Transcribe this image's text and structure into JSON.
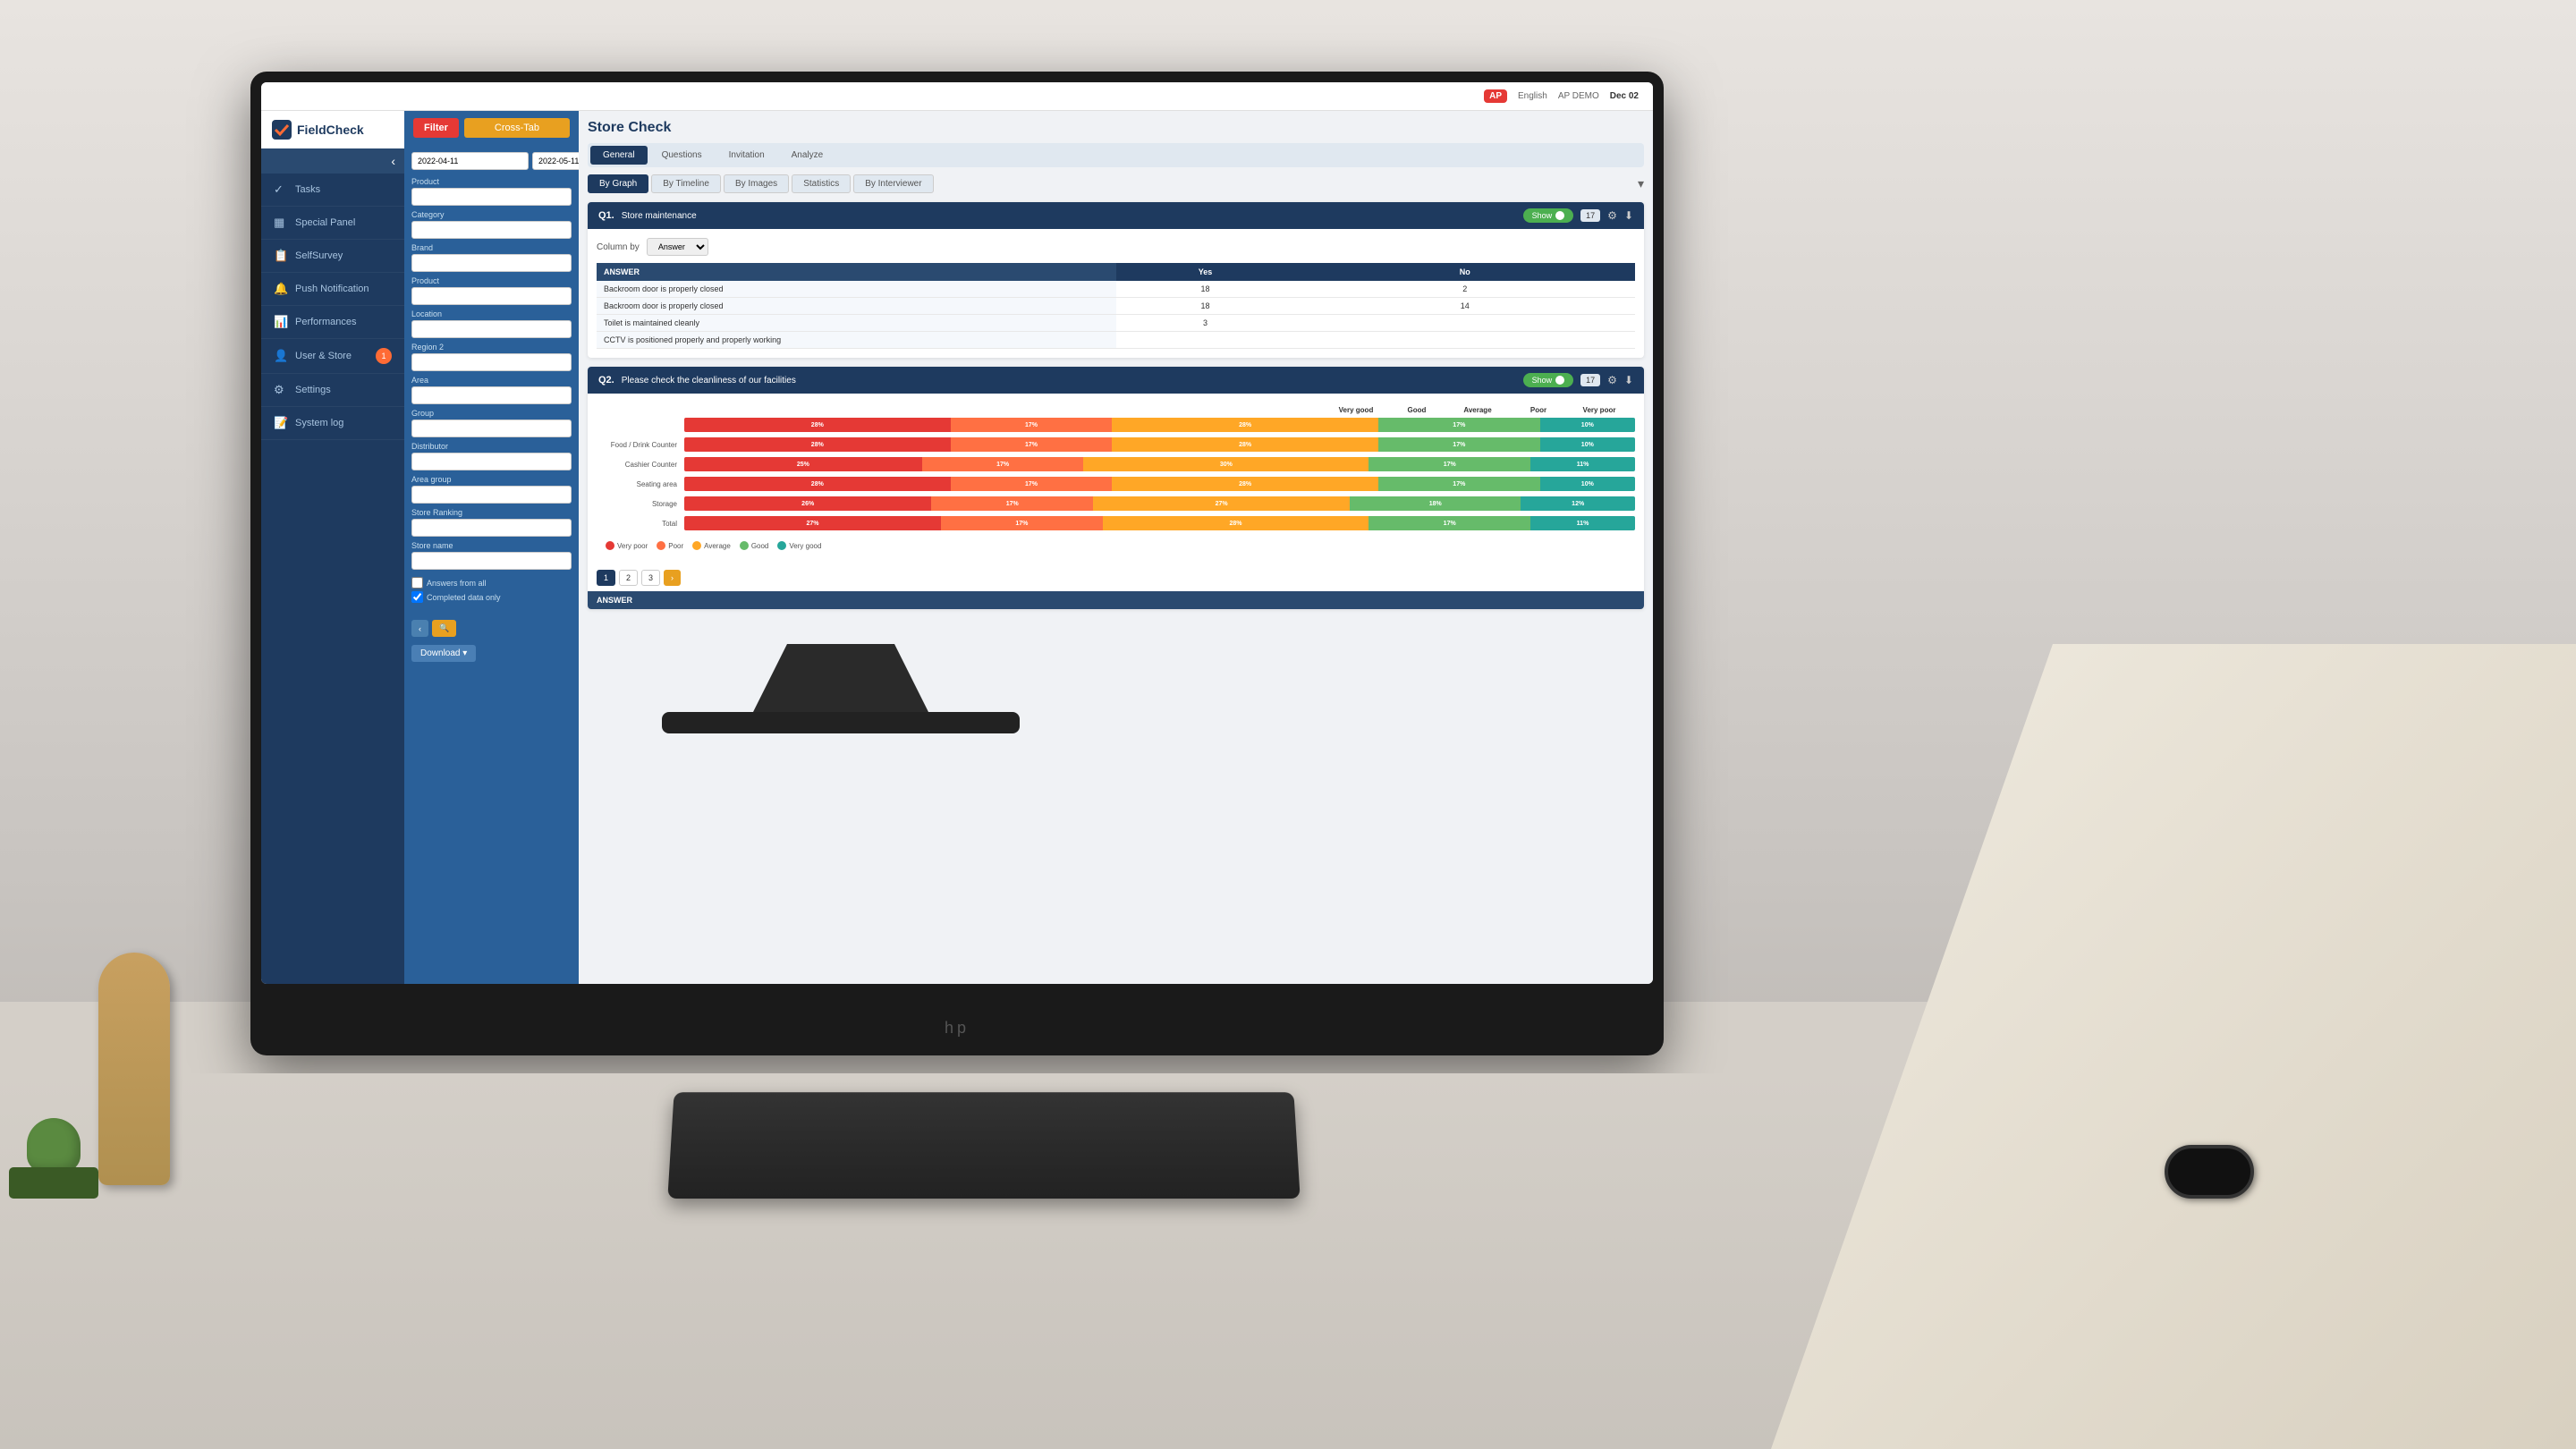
{
  "topbar": {
    "badge": "AP",
    "language": "English",
    "user": "AP DEMO",
    "date": "Dec 02"
  },
  "sidebar": {
    "logo": "FieldCheck",
    "items": [
      {
        "id": "tasks",
        "label": "Tasks",
        "icon": "✓",
        "active": false
      },
      {
        "id": "special-panel",
        "label": "Special Panel",
        "icon": "▦",
        "active": false
      },
      {
        "id": "selfsurvey",
        "label": "SelfSurvey",
        "icon": "📋",
        "active": false
      },
      {
        "id": "push-notification",
        "label": "Push Notification",
        "icon": "🔔",
        "active": false
      },
      {
        "id": "performances",
        "label": "Performances",
        "icon": "📊",
        "active": false
      },
      {
        "id": "user-store",
        "label": "User & Store",
        "icon": "👤",
        "active": false,
        "badge": "1"
      },
      {
        "id": "settings",
        "label": "Settings",
        "icon": "⚙",
        "active": false
      },
      {
        "id": "system-log",
        "label": "System log",
        "icon": "📝",
        "active": false
      }
    ]
  },
  "filter": {
    "filter_btn": "Filter",
    "cross_tab_btn": "Cross-Tab",
    "date_from": "2022-04-11",
    "date_to": "2022-05-11",
    "fields": [
      {
        "id": "product",
        "label": "Product",
        "value": ""
      },
      {
        "id": "category",
        "label": "Category",
        "value": ""
      },
      {
        "id": "brand",
        "label": "Brand",
        "value": ""
      },
      {
        "id": "product2",
        "label": "Product",
        "value": ""
      },
      {
        "id": "location",
        "label": "Location",
        "value": ""
      },
      {
        "id": "region2",
        "label": "Region 2",
        "value": ""
      },
      {
        "id": "area",
        "label": "Area",
        "value": ""
      },
      {
        "id": "group",
        "label": "Group",
        "value": ""
      },
      {
        "id": "distributor",
        "label": "Distributor",
        "value": ""
      },
      {
        "id": "area-group",
        "label": "Area group",
        "value": ""
      },
      {
        "id": "store-ranking",
        "label": "Store Ranking",
        "value": ""
      },
      {
        "id": "store-name",
        "label": "Store name",
        "value": ""
      }
    ],
    "options": [
      {
        "id": "answers-from-all",
        "label": "Answers from all",
        "checked": false
      },
      {
        "id": "completed-data-only",
        "label": "Completed data only",
        "checked": true
      }
    ],
    "download_btn": "Download ▾"
  },
  "page": {
    "title": "Store Check"
  },
  "tabs": {
    "main": [
      {
        "id": "general",
        "label": "General",
        "active": true
      },
      {
        "id": "questions",
        "label": "Questions",
        "active": false
      },
      {
        "id": "invitation",
        "label": "Invitation",
        "active": false
      },
      {
        "id": "analyze",
        "label": "Analyze",
        "active": false
      }
    ],
    "sub": [
      {
        "id": "by-graph",
        "label": "By Graph",
        "active": true
      },
      {
        "id": "by-timeline",
        "label": "By Timeline",
        "active": false
      },
      {
        "id": "by-images",
        "label": "By Images",
        "active": false
      },
      {
        "id": "statistics",
        "label": "Statistics",
        "active": false
      },
      {
        "id": "by-interviewer",
        "label": "By Interviewer",
        "active": false
      }
    ]
  },
  "questions": [
    {
      "id": "q1",
      "number": "Q1.",
      "title": "Store maintenance",
      "show": true,
      "count": "17",
      "column_by": "Answer",
      "headers": [
        "",
        "Yes",
        "",
        "No",
        ""
      ],
      "rows": [
        {
          "answer": "Backroom door is properly closed",
          "yes": "18",
          "yes_pct": "",
          "no": "2",
          "no_pct": ""
        },
        {
          "answer": "Backroom door is properly closed",
          "yes": "18",
          "yes_pct": "",
          "no": "14",
          "no_pct": ""
        },
        {
          "answer": "Toilet is maintained cleanly",
          "yes": "3",
          "yes_pct": "",
          "no": "",
          "no_pct": ""
        },
        {
          "answer": "CCTV is positioned properly and properly working",
          "yes": "",
          "yes_pct": "",
          "no": "",
          "no_pct": ""
        }
      ]
    },
    {
      "id": "q2",
      "number": "Q2.",
      "title": "Please check the cleanliness of our facilities",
      "show": true,
      "count": "17",
      "chart_rows": [
        {
          "label": "",
          "very_poor": 28,
          "poor": 17,
          "average": 28,
          "good": 17,
          "very_good": 10
        },
        {
          "label": "Food / Drink Counter",
          "very_poor": 28,
          "poor": 17,
          "average": 28,
          "good": 17,
          "very_good": 10
        },
        {
          "label": "Cashier Counter",
          "very_poor": 25,
          "poor": 17,
          "average": 30,
          "good": 17,
          "very_good": 11
        },
        {
          "label": "Seating area",
          "very_poor": 28,
          "poor": 17,
          "average": 28,
          "good": 17,
          "very_good": 10
        },
        {
          "label": "Storage",
          "very_poor": 26,
          "poor": 17,
          "average": 27,
          "good": 18,
          "very_good": 12
        },
        {
          "label": "Total",
          "very_poor": 27,
          "poor": 17,
          "average": 28,
          "good": 17,
          "very_good": 11
        }
      ],
      "legend": [
        {
          "label": "Very poor",
          "color": "#e53935"
        },
        {
          "label": "Poor",
          "color": "#ff7043"
        },
        {
          "label": "Average",
          "color": "#ffa726"
        },
        {
          "label": "Good",
          "color": "#66bb6a"
        },
        {
          "label": "Very good",
          "color": "#26a69a"
        }
      ],
      "score_headers": [
        "Very good",
        "Good",
        "Average",
        "Poor",
        "Very poor"
      ],
      "pagination": [
        "1",
        "2",
        "3",
        "..."
      ],
      "answer_label": "ANSWER"
    }
  ],
  "monitor": {
    "brand": "hp"
  }
}
